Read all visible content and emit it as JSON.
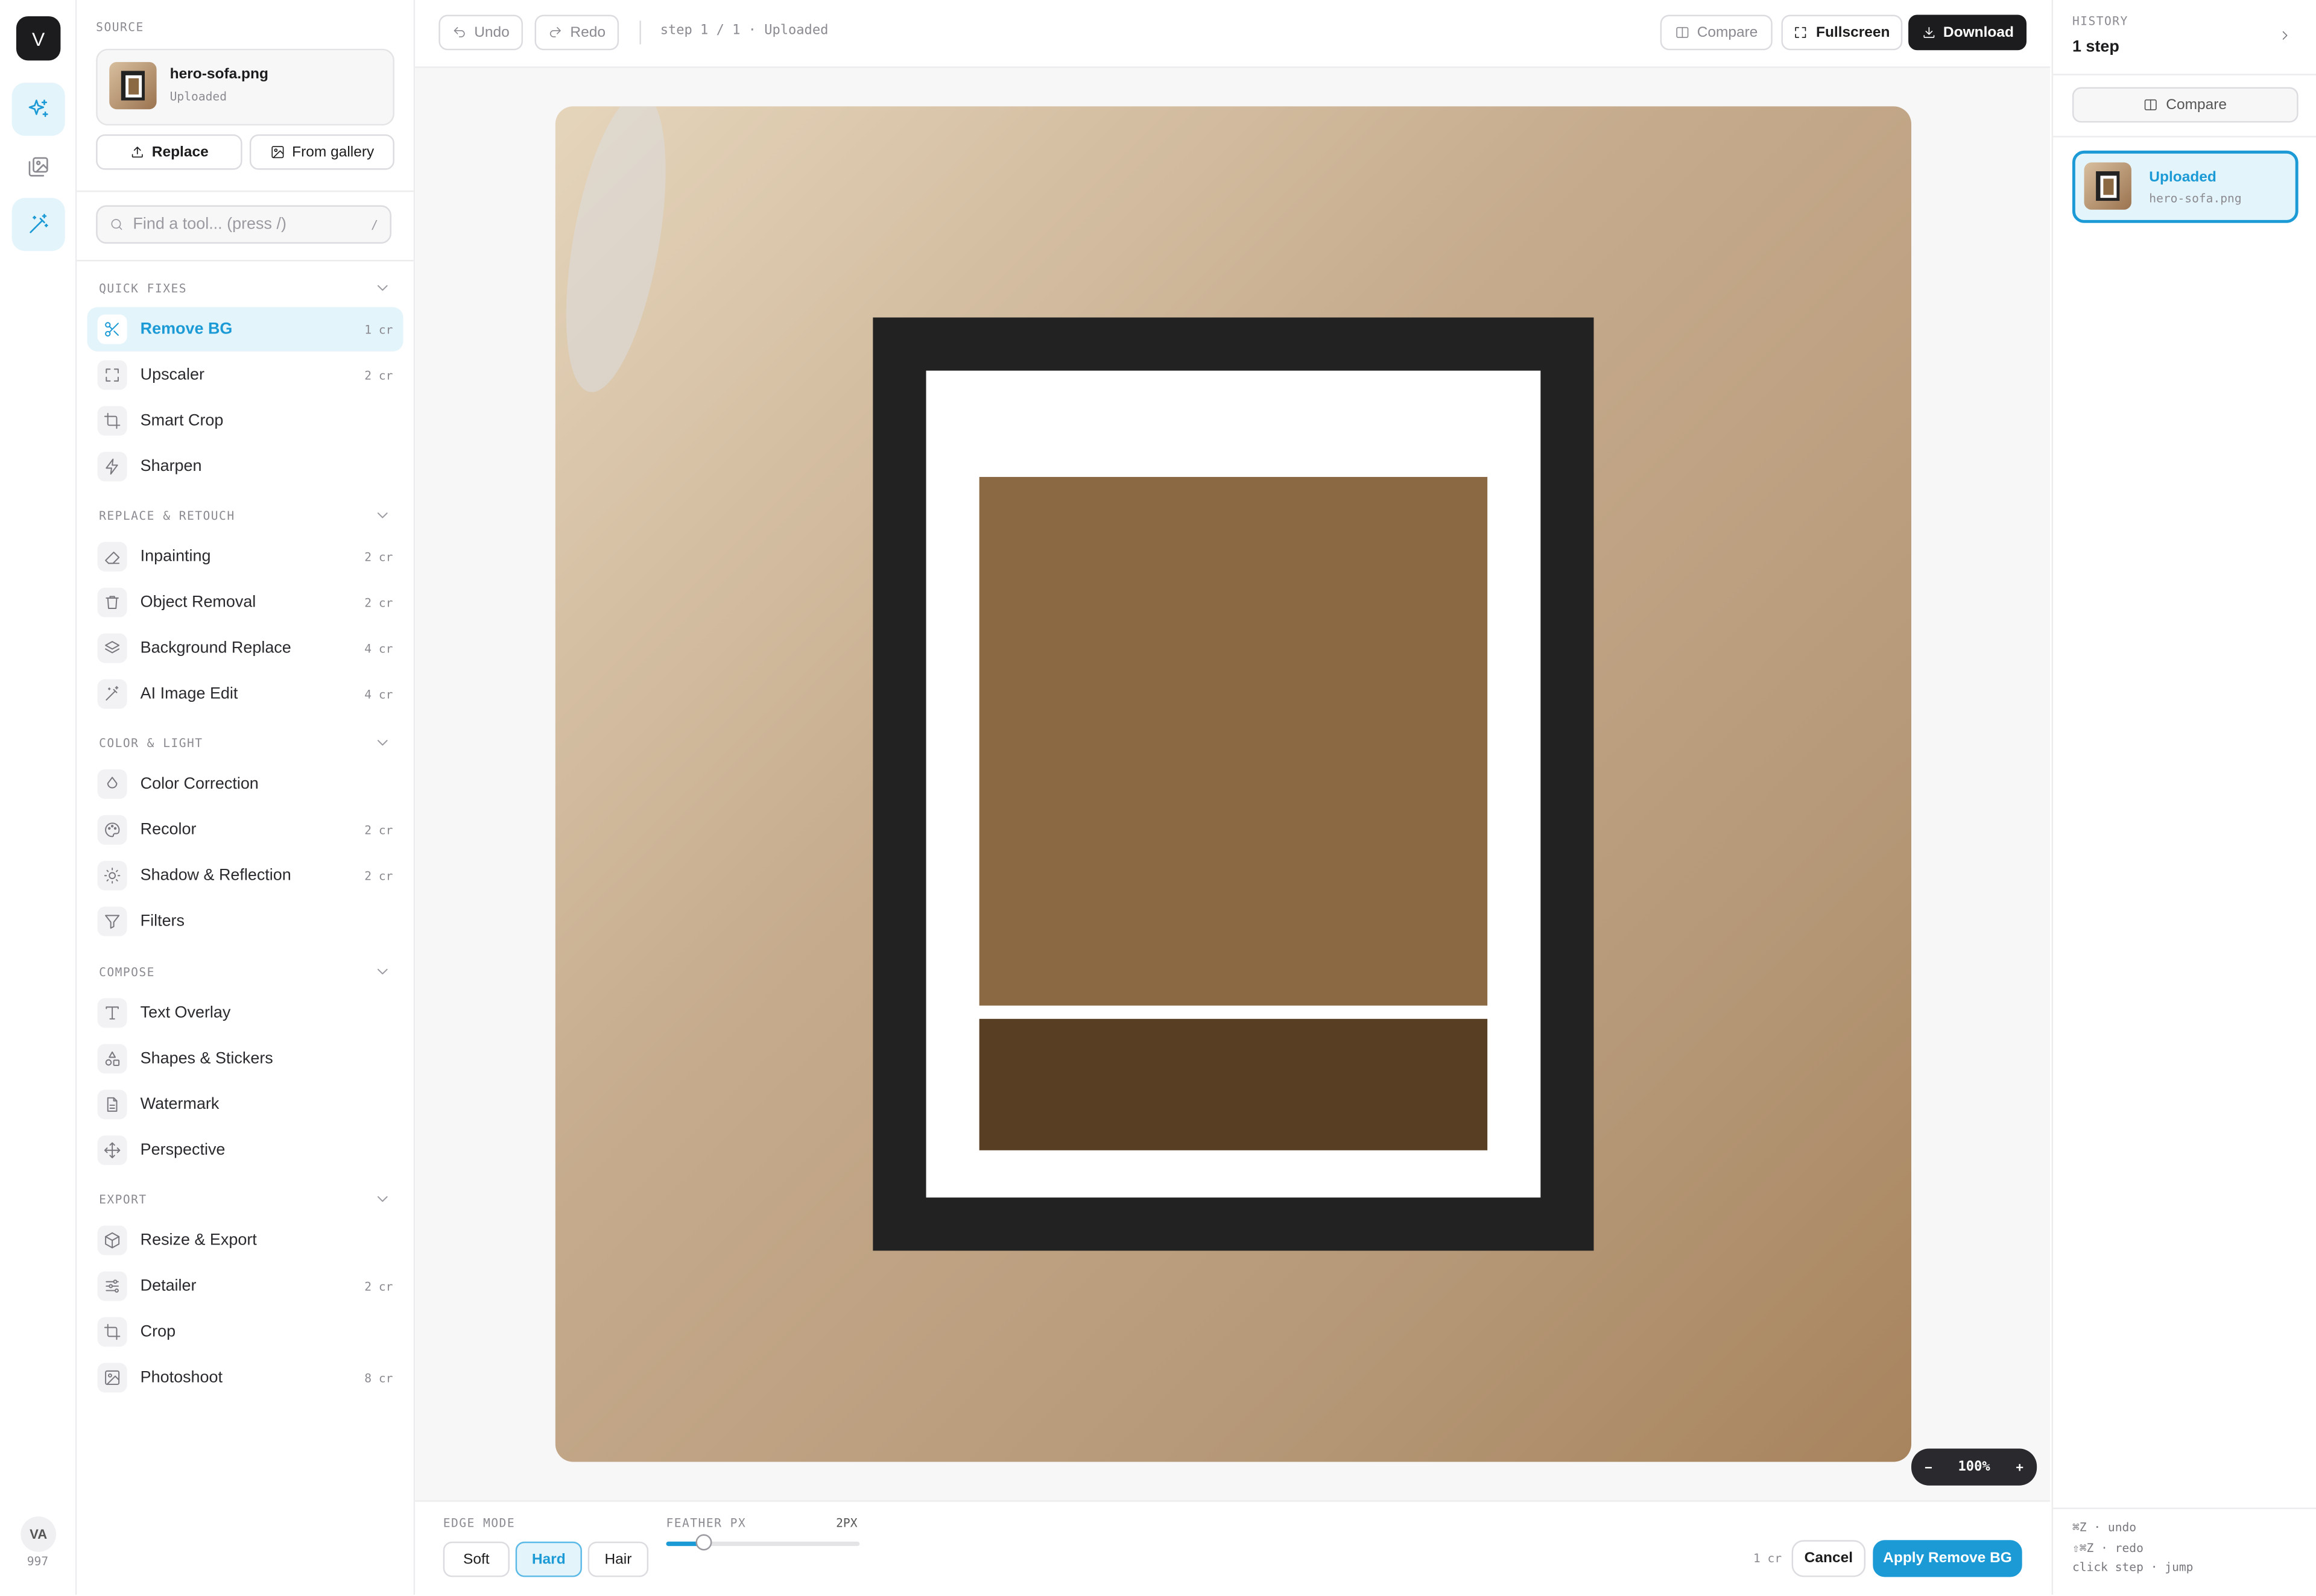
{
  "rail": {
    "logo_letter": "V",
    "items": [
      {
        "name": "sparkles-icon",
        "active": true
      },
      {
        "name": "gallery-icon",
        "active": false
      },
      {
        "name": "magic-wand-icon",
        "active": true
      }
    ],
    "avatar_initials": "VA",
    "credits": "997"
  },
  "source": {
    "section_label": "SOURCE",
    "filename": "hero-sofa.png",
    "status": "Uploaded",
    "replace_label": "Replace",
    "gallery_label": "From gallery"
  },
  "search": {
    "placeholder": "Find a tool... (press /)",
    "shortcut": "/"
  },
  "groups": [
    {
      "label": "QUICK FIXES",
      "tools": [
        {
          "label": "Remove BG",
          "cost": "1 cr",
          "icon": "scissors-icon",
          "active": true
        },
        {
          "label": "Upscaler",
          "cost": "2 cr",
          "icon": "expand-icon"
        },
        {
          "label": "Smart Crop",
          "cost": "",
          "icon": "crop-icon"
        },
        {
          "label": "Sharpen",
          "cost": "",
          "icon": "bolt-icon"
        }
      ]
    },
    {
      "label": "REPLACE & RETOUCH",
      "tools": [
        {
          "label": "Inpainting",
          "cost": "2 cr",
          "icon": "eraser-icon"
        },
        {
          "label": "Object Removal",
          "cost": "2 cr",
          "icon": "trash-icon"
        },
        {
          "label": "Background Replace",
          "cost": "4 cr",
          "icon": "layers-icon"
        },
        {
          "label": "AI Image Edit",
          "cost": "4 cr",
          "icon": "magic-wand-icon"
        }
      ]
    },
    {
      "label": "COLOR & LIGHT",
      "tools": [
        {
          "label": "Color Correction",
          "cost": "",
          "icon": "droplet-icon"
        },
        {
          "label": "Recolor",
          "cost": "2 cr",
          "icon": "palette-icon"
        },
        {
          "label": "Shadow & Reflection",
          "cost": "2 cr",
          "icon": "sun-icon"
        },
        {
          "label": "Filters",
          "cost": "",
          "icon": "filter-icon"
        }
      ]
    },
    {
      "label": "COMPOSE",
      "tools": [
        {
          "label": "Text Overlay",
          "cost": "",
          "icon": "type-icon"
        },
        {
          "label": "Shapes & Stickers",
          "cost": "",
          "icon": "shapes-icon"
        },
        {
          "label": "Watermark",
          "cost": "",
          "icon": "document-icon"
        },
        {
          "label": "Perspective",
          "cost": "",
          "icon": "move-icon"
        }
      ]
    },
    {
      "label": "EXPORT",
      "tools": [
        {
          "label": "Resize & Export",
          "cost": "",
          "icon": "package-icon"
        },
        {
          "label": "Detailer",
          "cost": "2 cr",
          "icon": "sliders-icon"
        },
        {
          "label": "Crop",
          "cost": "",
          "icon": "crop-icon"
        },
        {
          "label": "Photoshoot",
          "cost": "8 cr",
          "icon": "image-icon"
        }
      ]
    }
  ],
  "topbar": {
    "undo_label": "Undo",
    "redo_label": "Redo",
    "step_text": "step 1 / 1 · Uploaded",
    "compare_label": "Compare",
    "fullscreen_label": "Fullscreen",
    "download_label": "Download"
  },
  "zoom": {
    "minus": "−",
    "level": "100%",
    "plus": "+"
  },
  "bottombar": {
    "edge_mode_label": "EDGE MODE",
    "edge_modes": [
      {
        "label": "Soft",
        "active": false
      },
      {
        "label": "Hard",
        "active": true
      },
      {
        "label": "Hair",
        "active": false
      }
    ],
    "feather_label": "FEATHER PX",
    "feather_value_text": "2PX",
    "feather_fraction": 0.2,
    "cost": "1 cr",
    "cancel_label": "Cancel",
    "apply_label": "Apply Remove BG"
  },
  "history": {
    "label": "HISTORY",
    "count": "1 step",
    "compare_label": "Compare",
    "steps": [
      {
        "title": "Uploaded",
        "file": "hero-sofa.png"
      }
    ],
    "shortcuts": [
      "⌘Z · undo",
      "⇧⌘Z · redo",
      "click step · jump"
    ]
  },
  "colors": {
    "accent": "#1b9ad6",
    "accent_bg": "#e4f4fb",
    "dark": "#1c1c1e"
  }
}
